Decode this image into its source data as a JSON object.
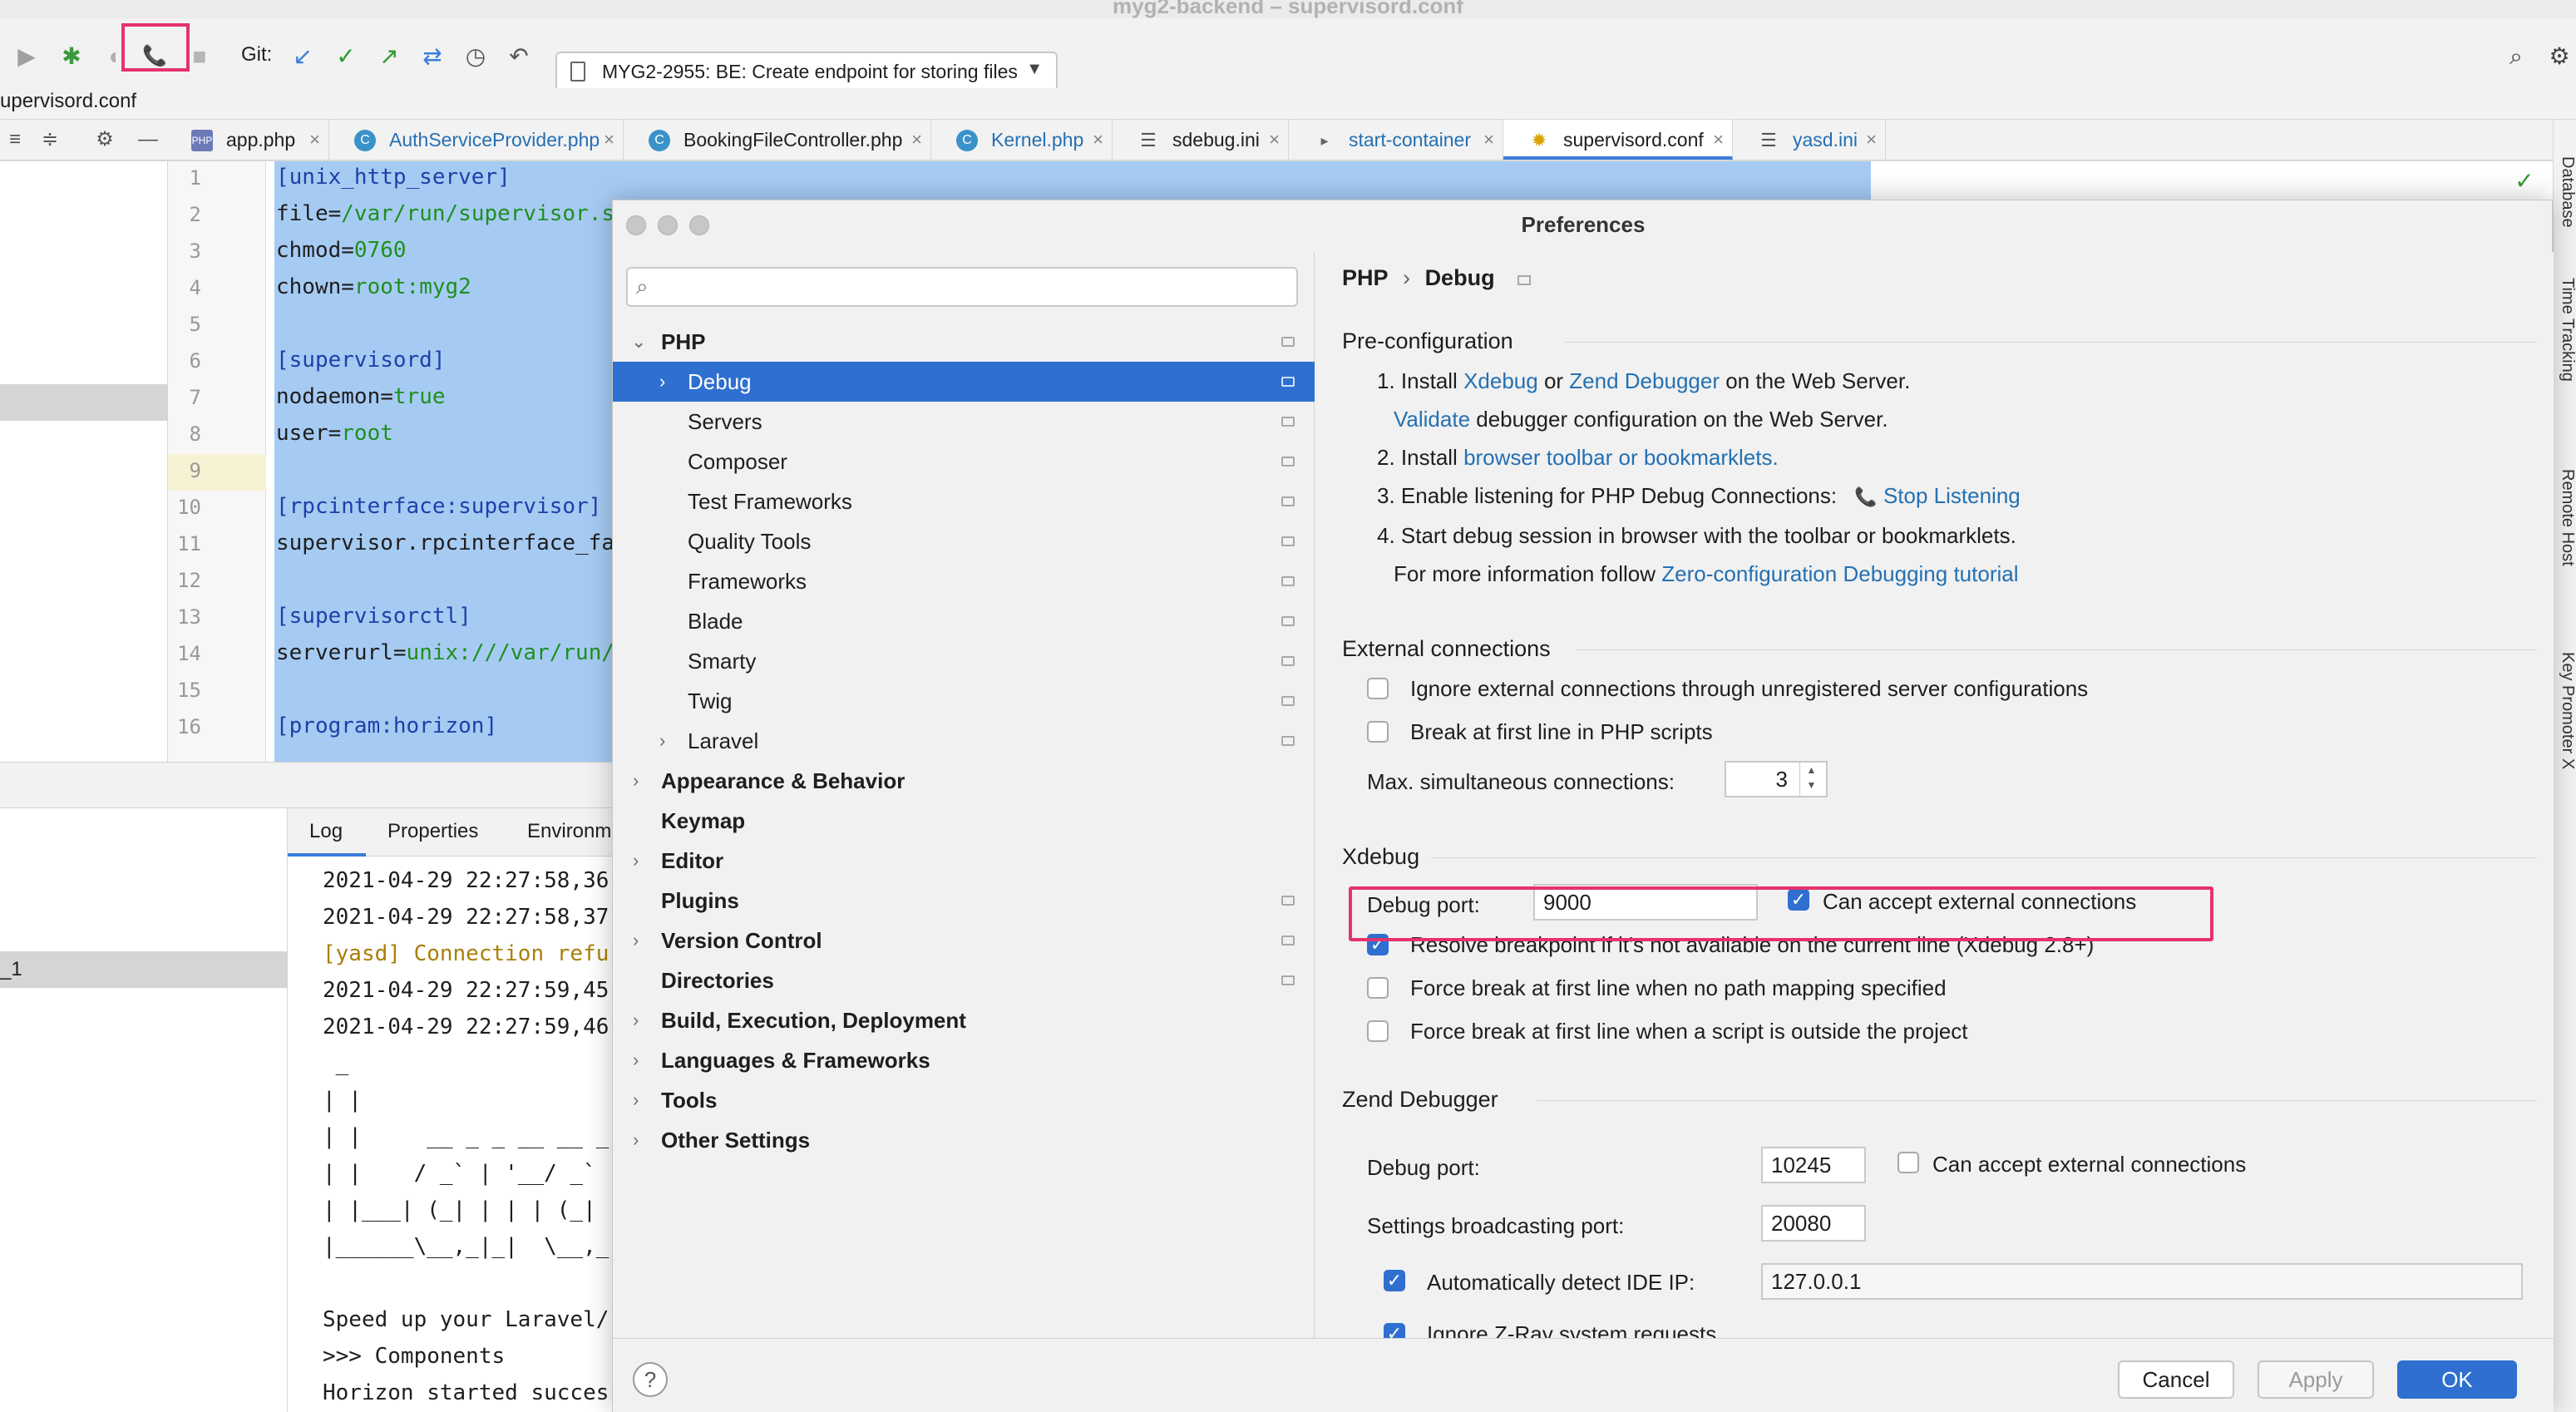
{
  "window": {
    "title": "myg2-backend – supervisord.conf"
  },
  "toolbar": {
    "git_label": "Git:",
    "branch": "MYG2-2955: BE: Create endpoint for storing files"
  },
  "path_bar": {
    "text": "upervisord.conf"
  },
  "tabs": [
    {
      "label": "app.php",
      "icon": "php-file-icon"
    },
    {
      "label": "AuthServiceProvider.php",
      "icon": "php-class-icon"
    },
    {
      "label": "BookingFileController.php",
      "icon": "php-class-icon"
    },
    {
      "label": "Kernel.php",
      "icon": "php-class-icon"
    },
    {
      "label": "sdebug.ini",
      "icon": "ini-file-icon"
    },
    {
      "label": "start-container",
      "icon": "shell-file-icon"
    },
    {
      "label": "supervisord.conf",
      "icon": "config-file-icon"
    },
    {
      "label": "yasd.ini",
      "icon": "ini-file-icon"
    }
  ],
  "right_strip": [
    "Database",
    "Time Tracking",
    "Remote Host",
    "Key Promoter X"
  ],
  "editor": {
    "line_numbers": [
      "1",
      "2",
      "3",
      "4",
      "5",
      "6",
      "7",
      "8",
      "9",
      "10",
      "11",
      "12",
      "13",
      "14",
      "15",
      "16"
    ],
    "lines": {
      "l1": "[unix_http_server]",
      "l2k": "file=",
      "l2v": "/var/run/supervisor.s",
      "l3k": "chmod=",
      "l3v": "0760",
      "l4k": "chown=",
      "l4v": "root:myg2",
      "l6": "[supervisord]",
      "l7k": "nodaemon=",
      "l7v": "true",
      "l8k": "user=",
      "l8v": "root",
      "l10": "[rpcinterface:supervisor]",
      "l11": "supervisor.rpcinterface_fa",
      "l13": "[supervisorctl]",
      "l14k": "serverurl=",
      "l14v": "unix:///var/run/",
      "l16": "[program:horizon]"
    }
  },
  "bottom": {
    "left_item": "_1",
    "log_tabs": [
      "Log",
      "Properties",
      "Environm"
    ],
    "log_lines": [
      "2021-04-29 22:27:58,36",
      "2021-04-29 22:27:58,37",
      "[yasd] Connection refu",
      "2021-04-29 22:27:59,45",
      "2021-04-29 22:27:59,46",
      " _",
      "| |",
      "| |     __ _ _ __ __ _",
      "| |    / _` | '__/ _`",
      "| |___| (_| | | | (_|",
      "|______\\__,_|_|  \\__,_",
      "",
      "Speed up your Laravel/",
      ">>> Components",
      "Horizon started succes"
    ]
  },
  "dialog": {
    "title": "Preferences",
    "search": {
      "placeholder": "",
      "value": ""
    },
    "tree": [
      {
        "label": "PHP",
        "expanded": true
      },
      {
        "label": "Debug",
        "selected": true
      },
      {
        "label": "Servers"
      },
      {
        "label": "Composer"
      },
      {
        "label": "Test Frameworks"
      },
      {
        "label": "Quality Tools"
      },
      {
        "label": "Frameworks"
      },
      {
        "label": "Blade"
      },
      {
        "label": "Smarty"
      },
      {
        "label": "Twig"
      },
      {
        "label": "Laravel"
      },
      {
        "label": "Appearance & Behavior"
      },
      {
        "label": "Keymap"
      },
      {
        "label": "Editor"
      },
      {
        "label": "Plugins"
      },
      {
        "label": "Version Control"
      },
      {
        "label": "Directories"
      },
      {
        "label": "Build, Execution, Deployment"
      },
      {
        "label": "Languages & Frameworks"
      },
      {
        "label": "Tools"
      },
      {
        "label": "Other Settings"
      }
    ],
    "breadcrumb": {
      "parent": "PHP",
      "sep": "›",
      "current": "Debug"
    },
    "preconfig": {
      "title": "Pre-configuration",
      "s1_a": "1. Install ",
      "s1_xdebug": "Xdebug",
      "s1_or": " or ",
      "s1_zend": "Zend Debugger",
      "s1_b": " on the Web Server.",
      "s1_validate": "Validate",
      "s1_c": " debugger configuration on the Web Server.",
      "s2_a": "2. Install ",
      "s2_link": "browser toolbar or bookmarklets.",
      "s3_a": "3. Enable listening for PHP Debug Connections:",
      "s3_link": "Stop Listening",
      "s4": "4. Start debug session in browser with the toolbar or bookmarklets.",
      "s5_a": "For more information follow ",
      "s5_link": "Zero-configuration Debugging tutorial"
    },
    "external": {
      "title": "External connections",
      "ignore_label": "Ignore external connections through unregistered server configurations",
      "ignore_checked": false,
      "break_label": "Break at first line in PHP scripts",
      "break_checked": false,
      "max_label": "Max. simultaneous connections:",
      "max_value": "3"
    },
    "xdebug": {
      "title": "Xdebug",
      "port_label": "Debug port:",
      "port_value": "9000",
      "accept_label": "Can accept external connections",
      "accept_checked": true,
      "resolve_label": "Resolve breakpoint if it's not available on the current line (Xdebug 2.8+)",
      "resolve_checked": true,
      "force_path_label": "Force break at first line when no path mapping specified",
      "force_path_checked": false,
      "force_outside_label": "Force break at first line when a script is outside the project",
      "force_outside_checked": false
    },
    "zend": {
      "title": "Zend Debugger",
      "port_label": "Debug port:",
      "port_value": "10245",
      "accept_label": "Can accept external connections",
      "accept_checked": false,
      "broadcast_label": "Settings broadcasting port:",
      "broadcast_value": "20080",
      "detect_label": "Automatically detect IDE IP:",
      "detect_checked": true,
      "detect_value": "127.0.0.1",
      "zray_label": "Ignore Z-Ray system requests",
      "zray_checked": true
    },
    "footer": {
      "help": "?",
      "cancel": "Cancel",
      "apply": "Apply",
      "ok": "OK"
    }
  },
  "colors": {
    "accent": "#2e6fd0",
    "highlight": "#e5336c",
    "link": "#2470b3",
    "keyword": "#1d40a8",
    "string": "#1f8f1f"
  }
}
